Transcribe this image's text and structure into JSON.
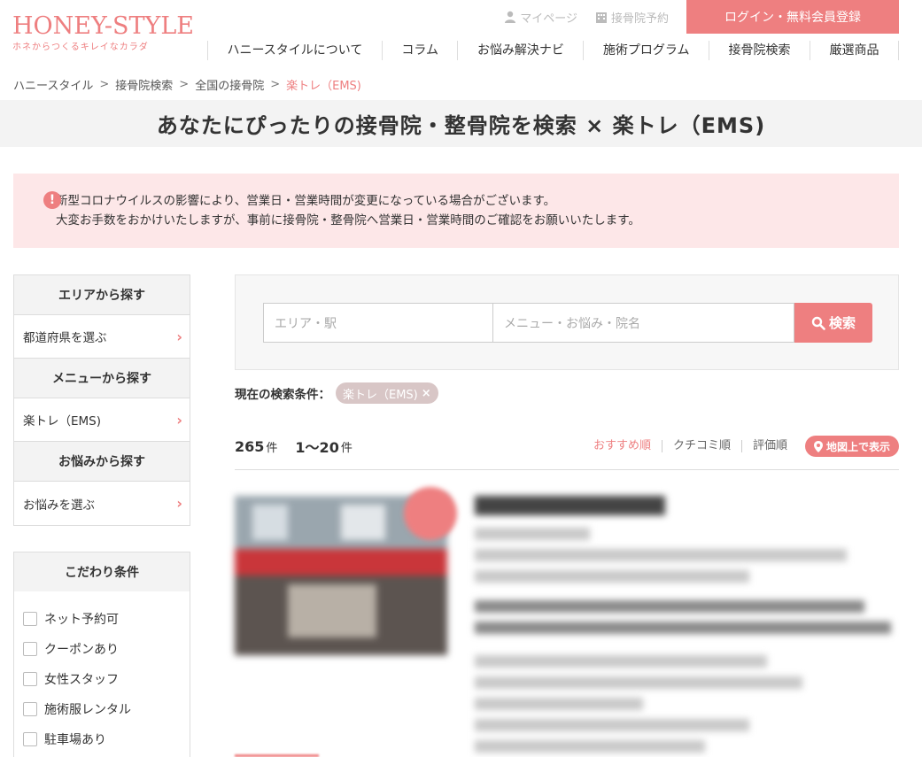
{
  "header": {
    "logo_main": "HONEY-STYLE",
    "logo_sub": "ホネからつくるキレイなカラダ",
    "mypage": "マイページ",
    "reservation": "接骨院予約",
    "login": "ログイン・無料会員登録"
  },
  "nav": [
    "ハニースタイルについて",
    "コラム",
    "お悩み解決ナビ",
    "施術プログラム",
    "接骨院検索",
    "厳選商品"
  ],
  "breadcrumb": [
    "ハニースタイル",
    "接骨院検索",
    "全国の接骨院",
    "楽トレ（EMS)"
  ],
  "breadcrumb_sep": ">",
  "page_title": "あなたにぴったりの接骨院・整骨院を検索 × 楽トレ（EMS)",
  "notice": {
    "icon": "!",
    "line1": "新型コロナウイルスの影響により、営業日・営業時間が変更になっている場合がございます。",
    "line2": "大変お手数をおかけいたしますが、事前に接骨院・整骨院へ営業日・営業時間のご確認をお願いいたします。"
  },
  "sidebar": {
    "area_head": "エリアから探す",
    "area_link": "都道府県を選ぶ",
    "menu_head": "メニューから探す",
    "menu_link": "楽トレ（EMS)",
    "worry_head": "お悩みから探す",
    "worry_link": "お悩みを選ぶ",
    "chevron": "›",
    "cond_head": "こだわり条件",
    "conditions": [
      "ネット予約可",
      "クーポンあり",
      "女性スタッフ",
      "施術服レンタル",
      "駐車場あり"
    ]
  },
  "search": {
    "area_placeholder": "エリア・駅",
    "menu_placeholder": "メニュー・お悩み・院名",
    "button": "検索"
  },
  "current_conditions": {
    "label": "現在の検索条件：",
    "tag": "楽トレ（EMS)",
    "tag_remove": "×"
  },
  "results": {
    "total": "265",
    "unit": "件",
    "range": "1〜20",
    "range_unit": "件",
    "sort": [
      "おすすめ順",
      "クチコミ順",
      "評価順"
    ],
    "map_button": "地図上で表示"
  },
  "colors": {
    "accent": "#ee7f80",
    "notice_bg": "#fde7e8",
    "band_bg": "#f3f3f3"
  }
}
